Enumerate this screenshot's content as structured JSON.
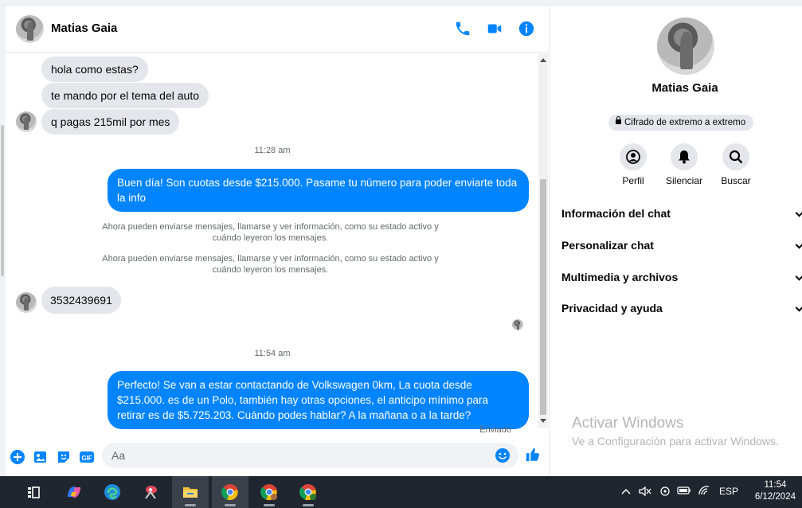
{
  "contact": {
    "name": "Matias Gaia"
  },
  "messages": [
    {
      "dir": "in",
      "text": "hola como estas?"
    },
    {
      "dir": "in",
      "text": "te mando por el tema del auto"
    },
    {
      "dir": "in",
      "text": "q pagas 215mil por mes"
    },
    {
      "type": "time",
      "text": "11:28 am"
    },
    {
      "dir": "out",
      "text": "Buen día! Son cuotas desde $215.000. Pasame tu número para poder enviarte toda la info"
    },
    {
      "type": "system",
      "text": "Ahora pueden enviarse mensajes, llamarse y ver información, como su estado activo y cuándo leyeron los mensajes."
    },
    {
      "type": "system",
      "text": "Ahora pueden enviarse mensajes, llamarse y ver información, como su estado activo y cuándo leyeron los mensajes."
    },
    {
      "dir": "in",
      "text": "3532439691"
    },
    {
      "type": "time",
      "text": "11:54 am"
    },
    {
      "dir": "out",
      "text": "Perfecto!  Se van a estar contactando de Volkswagen 0km, La cuota desde $215.000. es de un Polo, también hay otras opciones, el anticipo mínimo para retirar es de $5.725.203. Cuándo podes hablar? A la mañana o a la tarde?"
    }
  ],
  "status": {
    "sent": "Enviado"
  },
  "composer": {
    "placeholder": "Aa"
  },
  "panel": {
    "name": "Matias Gaia",
    "encryption": "Cifrado de extremo a extremo",
    "actions": {
      "profile": "Perfil",
      "mute": "Silenciar",
      "search": "Buscar"
    },
    "sections": [
      "Información del chat",
      "Personalizar chat",
      "Multimedia y archivos",
      "Privacidad y ayuda"
    ]
  },
  "watermark": {
    "title": "Activar Windows",
    "subtitle": "Ve a Configuración para activar Windows."
  },
  "taskbar": {
    "language": "ESP",
    "time": "11:54",
    "date": "6/12/2024"
  },
  "colors": {
    "accent": "#0084ff",
    "bubble_in": "#e4e6eb",
    "taskbar": "#20262f"
  }
}
